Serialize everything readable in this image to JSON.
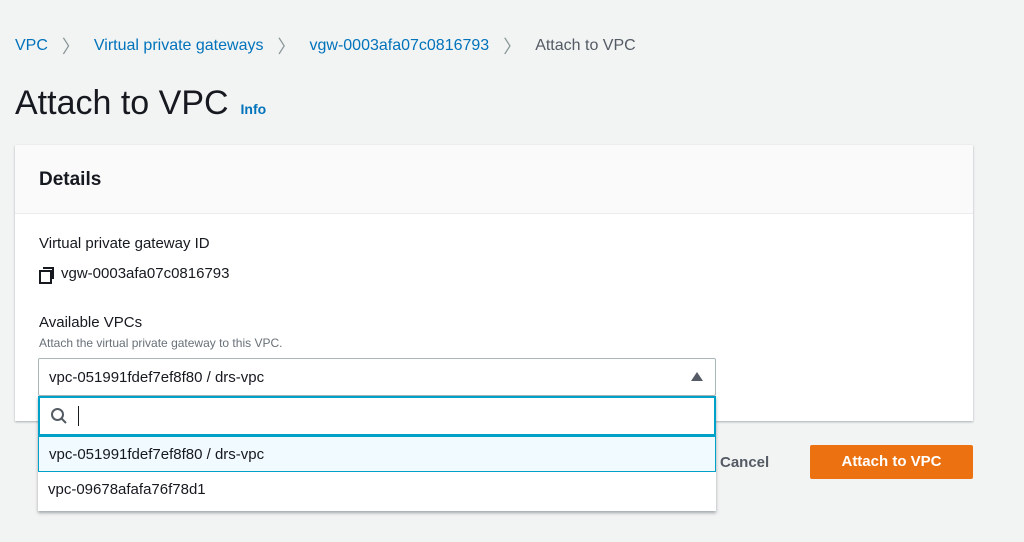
{
  "breadcrumb": [
    "VPC",
    "Virtual private gateways",
    "vgw-0003afa07c0816793",
    "Attach to VPC"
  ],
  "title": "Attach to VPC",
  "info": "Info",
  "panel": {
    "heading": "Details",
    "gw_label": "Virtual private gateway ID",
    "gw_value": "vgw-0003afa07c0816793",
    "vpc_label": "Available VPCs",
    "vpc_desc": "Attach the virtual private gateway to this VPC.",
    "selected": "vpc-051991fdef7ef8f80 / drs-vpc",
    "search_value": "",
    "options": [
      "vpc-051991fdef7ef8f80 / drs-vpc",
      "vpc-09678afafa76f78d1"
    ]
  },
  "actions": {
    "cancel": "Cancel",
    "attach": "Attach to VPC"
  }
}
